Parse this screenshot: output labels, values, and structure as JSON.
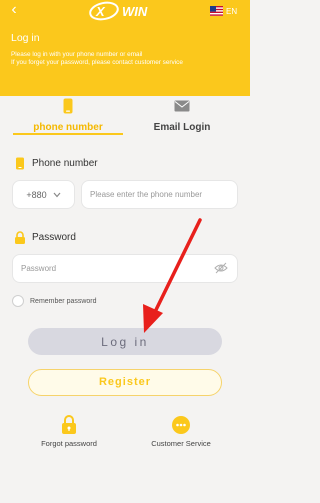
{
  "header": {
    "brand": "WIN",
    "language": "EN",
    "title": "Log in",
    "description_line1": "Please log in with your phone number or email",
    "description_line2": "If you forget your password, please contact customer service",
    "background_color": "#fbc81c"
  },
  "tabs": [
    {
      "label": "phone number",
      "icon": "phone-icon",
      "active": true
    },
    {
      "label": "Email Login",
      "icon": "envelope-icon",
      "active": false
    }
  ],
  "phone": {
    "label": "Phone number",
    "country_code": "+880",
    "placeholder": "Please enter the phone number"
  },
  "password": {
    "label": "Password",
    "placeholder": "Password"
  },
  "remember_label": "Remember password",
  "buttons": {
    "login": "Log in",
    "register": "Register"
  },
  "links": {
    "forgot": "Forgot password",
    "support": "Customer Service"
  },
  "colors": {
    "accent": "#fbc81c",
    "annotation_arrow": "#e8201c"
  }
}
